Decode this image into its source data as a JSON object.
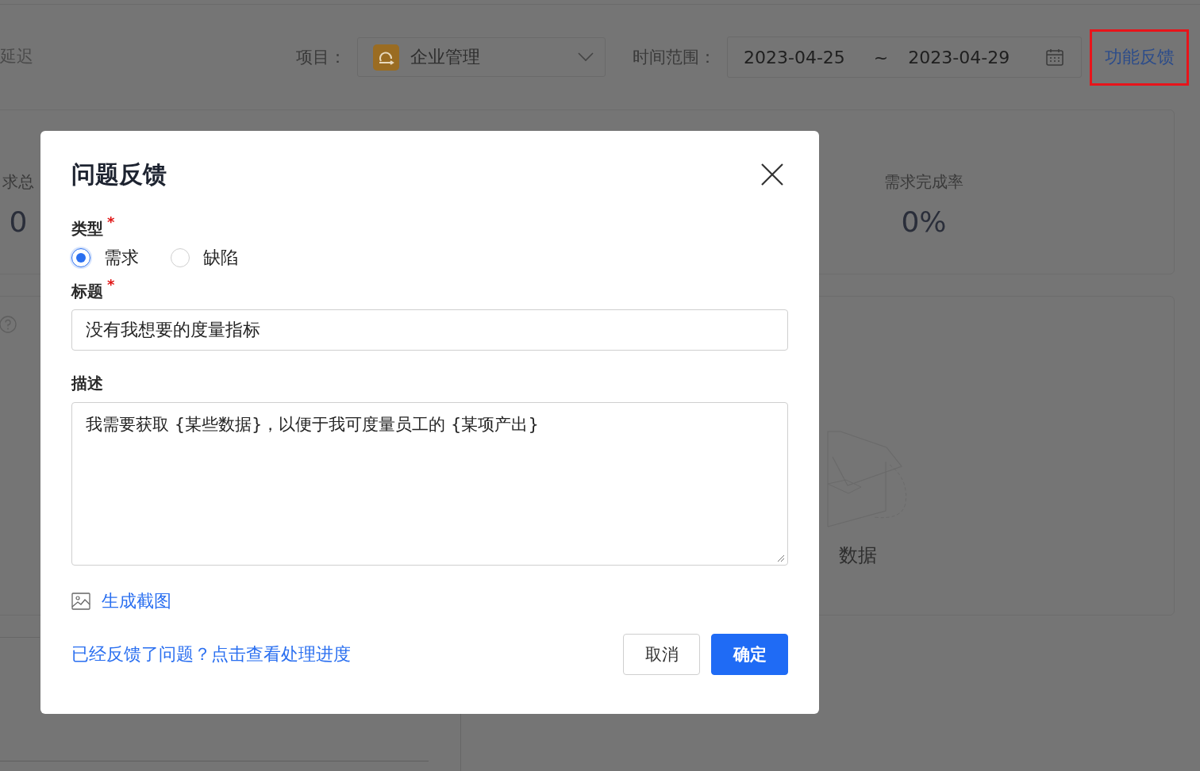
{
  "background": {
    "cut_label": "延迟",
    "project_label": "项目：",
    "project": "企业管理",
    "range_label": "时间范围：",
    "date_start": "2023-04-25",
    "range_sep": "~",
    "date_end": "2023-04-29",
    "feedback_link": "功能反馈",
    "stats": [
      {
        "label": "求总",
        "value": "0"
      },
      {
        "label": "需求完成率",
        "value": "0%"
      }
    ],
    "empty_text": "数据"
  },
  "dialog": {
    "title": "问题反馈",
    "type_field": {
      "label": "类型",
      "required_mark": "*",
      "options": [
        {
          "label": "需求",
          "selected": true
        },
        {
          "label": "缺陷",
          "selected": false
        }
      ]
    },
    "title_field": {
      "label": "标题",
      "required_mark": "*",
      "value": "没有我想要的度量指标"
    },
    "description_field": {
      "label": "描述",
      "value": "我需要获取 {某些数据}，以便于我可度量员工的 {某项产出}"
    },
    "screenshot_link": "生成截图",
    "progress_link": "已经反馈了问题？点击查看处理进度",
    "buttons": [
      {
        "label": "取消",
        "kind": "default"
      },
      {
        "label": "确定",
        "kind": "primary"
      }
    ]
  }
}
